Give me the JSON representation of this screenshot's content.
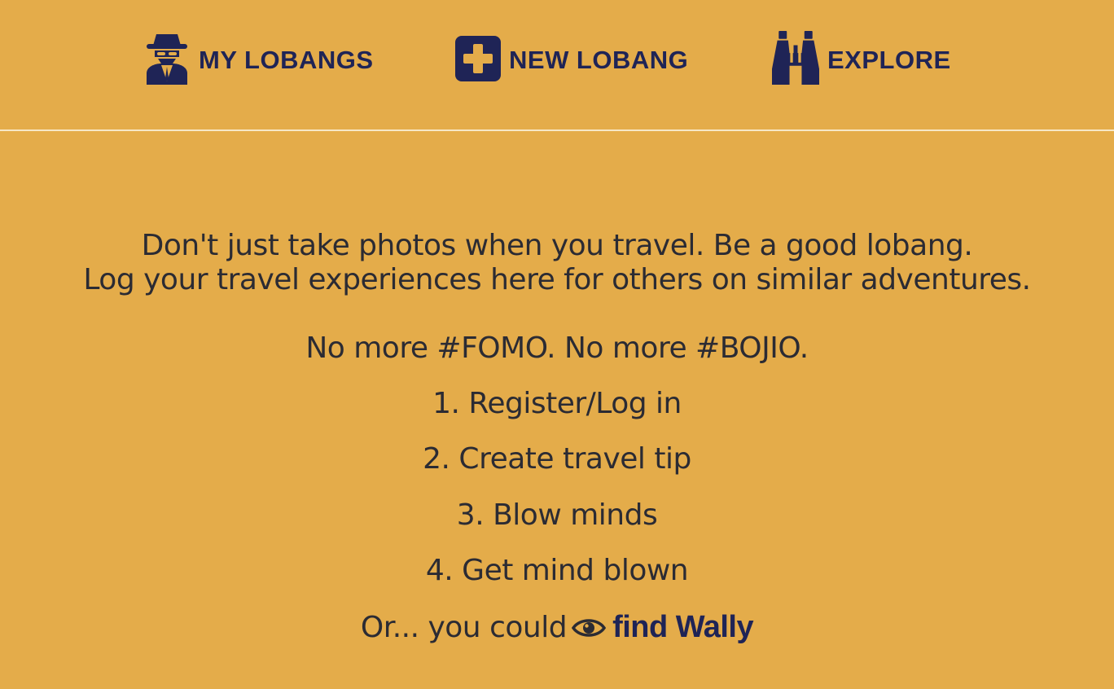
{
  "nav": {
    "items": [
      {
        "label": "MY LOBANGS",
        "icon": "spy-icon"
      },
      {
        "label": "NEW LOBANG",
        "icon": "plus-square-icon"
      },
      {
        "label": "EXPLORE",
        "icon": "binoculars-icon"
      }
    ]
  },
  "intro": {
    "line1": "Don't just take photos when you travel. Be a good lobang.",
    "line2": "Log your travel experiences here for others on similar adventures."
  },
  "tagline": "No more #FOMO. No more #BOJIO.",
  "steps": [
    "1. Register/Log in",
    "2. Create travel tip",
    "3. Blow minds",
    "4. Get mind blown"
  ],
  "wally": {
    "prefix": "Or... you could",
    "icon": "eye-icon",
    "link": "find Wally"
  },
  "colors": {
    "background": "#e4ac4a",
    "accent": "#1f2456",
    "text": "#2b2b33"
  }
}
